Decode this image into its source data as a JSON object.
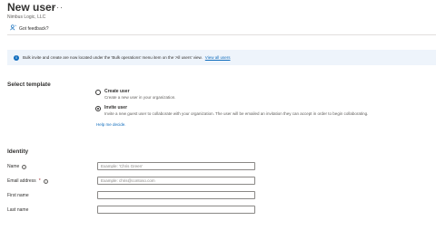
{
  "header": {
    "title": "New user",
    "more_label": "···",
    "org_name": "Nimbus Logic, LLC",
    "feedback_label": "Got feedback?"
  },
  "info_bar": {
    "text": "Bulk invite and create are now located under the 'Bulk operations' menu item on the 'All users' view.",
    "link": "View all users"
  },
  "template": {
    "heading": "Select template",
    "options": [
      {
        "label": "Create user",
        "description": "Create a new user in your organization.",
        "selected": false
      },
      {
        "label": "Invite user",
        "description": "Invite a new guest user to collaborate with your organization. The user will be emailed an invitation they can accept in order to begin collaborating.",
        "selected": true
      }
    ],
    "help_link": "Help me decide."
  },
  "identity": {
    "heading": "Identity",
    "fields": [
      {
        "label": "Name",
        "required": false,
        "has_info": true,
        "placeholder": "Example: 'Chris Green'",
        "value": ""
      },
      {
        "label": "Email address",
        "required": true,
        "has_info": true,
        "placeholder": "Example: chris@contoso.com",
        "value": ""
      },
      {
        "label": "First name",
        "required": false,
        "has_info": false,
        "placeholder": "",
        "value": ""
      },
      {
        "label": "Last name",
        "required": false,
        "has_info": false,
        "placeholder": "",
        "value": ""
      }
    ]
  },
  "colors": {
    "accent": "#0f6cbd",
    "info_bar_bg": "#eef4fb",
    "required_asterisk": "#a4262c"
  },
  "icons": {
    "more": "more-horizontal-icon",
    "feedback": "feedback-person-icon",
    "info": "info-icon"
  }
}
